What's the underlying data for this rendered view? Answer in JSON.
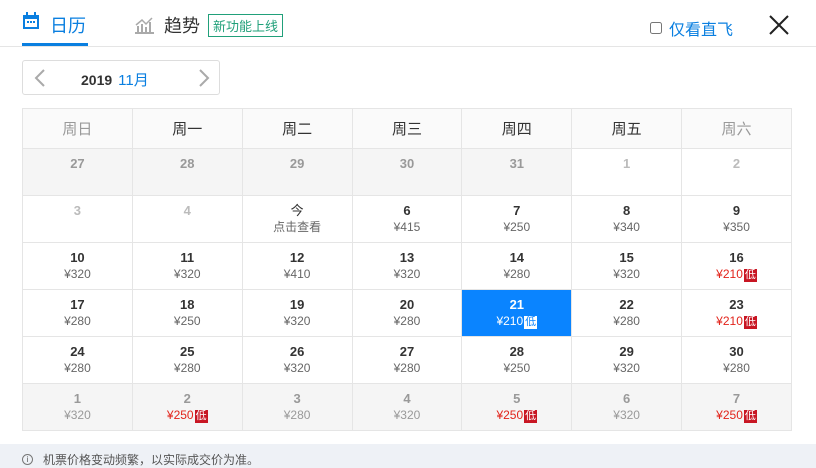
{
  "tabs": [
    {
      "label": "日历"
    },
    {
      "label": "趋势",
      "badge": "新功能上线"
    }
  ],
  "direct_only": {
    "label": "仅看直飞",
    "checked": false
  },
  "month_selector": {
    "year": "2019",
    "month": "11月"
  },
  "weekdays": [
    "周日",
    "周一",
    "周二",
    "周三",
    "周四",
    "周五",
    "周六"
  ],
  "weeks": [
    [
      {
        "day": "27",
        "state": "other"
      },
      {
        "day": "28",
        "state": "other"
      },
      {
        "day": "29",
        "state": "other"
      },
      {
        "day": "30",
        "state": "other"
      },
      {
        "day": "31",
        "state": "other"
      },
      {
        "day": "1",
        "state": "past"
      },
      {
        "day": "2",
        "state": "past"
      }
    ],
    [
      {
        "day": "3",
        "state": "past"
      },
      {
        "day": "4",
        "state": "past"
      },
      {
        "day": "今",
        "price": "点击查看",
        "state": "today"
      },
      {
        "day": "6",
        "price": "¥415"
      },
      {
        "day": "7",
        "price": "¥250"
      },
      {
        "day": "8",
        "price": "¥340"
      },
      {
        "day": "9",
        "price": "¥350"
      }
    ],
    [
      {
        "day": "10",
        "price": "¥320"
      },
      {
        "day": "11",
        "price": "¥320"
      },
      {
        "day": "12",
        "price": "¥410"
      },
      {
        "day": "13",
        "price": "¥320"
      },
      {
        "day": "14",
        "price": "¥280"
      },
      {
        "day": "15",
        "price": "¥320"
      },
      {
        "day": "16",
        "price": "¥210",
        "low": "低"
      }
    ],
    [
      {
        "day": "17",
        "price": "¥280"
      },
      {
        "day": "18",
        "price": "¥250"
      },
      {
        "day": "19",
        "price": "¥320"
      },
      {
        "day": "20",
        "price": "¥280"
      },
      {
        "day": "21",
        "price": "¥210",
        "low": "低",
        "state": "sel"
      },
      {
        "day": "22",
        "price": "¥280"
      },
      {
        "day": "23",
        "price": "¥210",
        "low": "低"
      }
    ],
    [
      {
        "day": "24",
        "price": "¥280"
      },
      {
        "day": "25",
        "price": "¥280"
      },
      {
        "day": "26",
        "price": "¥320"
      },
      {
        "day": "27",
        "price": "¥280"
      },
      {
        "day": "28",
        "price": "¥250"
      },
      {
        "day": "29",
        "price": "¥320"
      },
      {
        "day": "30",
        "price": "¥280"
      }
    ],
    [
      {
        "day": "1",
        "price": "¥320",
        "state": "other"
      },
      {
        "day": "2",
        "price": "¥250",
        "low": "低",
        "state": "other"
      },
      {
        "day": "3",
        "price": "¥280",
        "state": "other"
      },
      {
        "day": "4",
        "price": "¥320",
        "state": "other"
      },
      {
        "day": "5",
        "price": "¥250",
        "low": "低",
        "state": "other"
      },
      {
        "day": "6",
        "price": "¥320",
        "state": "other"
      },
      {
        "day": "7",
        "price": "¥250",
        "low": "低",
        "state": "other"
      }
    ]
  ],
  "footer": "机票价格变动频繁，以实际成交价为准。",
  "colors": {
    "accent": "#0a84ff",
    "low": "#e2231a",
    "badge": "#21a07a"
  }
}
